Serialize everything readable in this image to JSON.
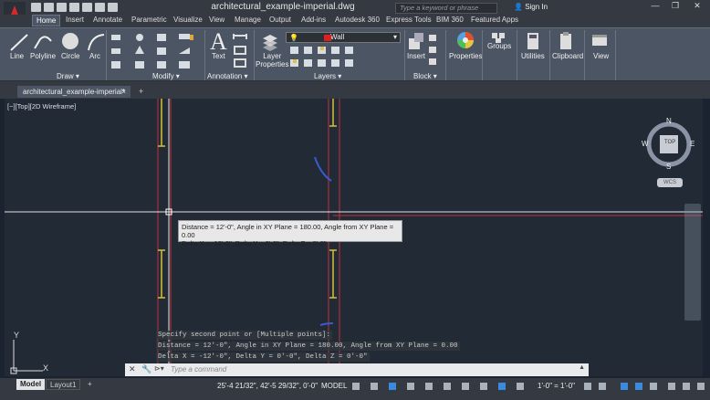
{
  "window": {
    "title": "architectural_example-imperial.dwg",
    "controls": [
      "—",
      "❐",
      "✕"
    ]
  },
  "search": {
    "placeholder": "Type a keyword or phrase"
  },
  "user": {
    "signin_label": "Sign In"
  },
  "ribbon_tabs": [
    "Home",
    "Insert",
    "Annotate",
    "Parametric",
    "Visualize",
    "View",
    "Manage",
    "Output",
    "Add-ins",
    "Autodesk 360",
    "Express Tools",
    "BIM 360",
    "Featured Apps"
  ],
  "active_tab": "Home",
  "ribbon": {
    "draw": {
      "title": "Draw ▾",
      "tools": [
        "Line",
        "Polyline",
        "Circle",
        "Arc"
      ]
    },
    "modify": {
      "title": "Modify ▾"
    },
    "annotation": {
      "title": "Annotation ▾",
      "text_label": "Text"
    },
    "layers": {
      "title": "Layers ▾",
      "properties_label": "Layer\nProperties",
      "current_layer": "Wall",
      "current_layer_color": "#e02020"
    },
    "block": {
      "title": "Block ▾",
      "insert_label": "Insert"
    },
    "properties_label": "Properties",
    "groups_label": "Groups",
    "utilities_label": "Utilities",
    "clipboard_label": "Clipboard",
    "view_label": "View"
  },
  "file_tab": {
    "label": "architectural_example-imperial*",
    "close": "×",
    "new": "+"
  },
  "viewport": {
    "label": "[−][Top][2D Wireframe]",
    "viewcube": {
      "top": "TOP",
      "n": "N",
      "s": "S",
      "e": "E",
      "w": "W",
      "wcs": "WCS"
    }
  },
  "tooltip": {
    "line1": "Distance = 12'-0\",  Angle in XY Plane = 180.00,  Angle from XY Plane = 0.00",
    "line2": "Delta X = -12'-0\",  Delta Y = 0'-0\",   Delta Z = 0'-0\""
  },
  "command_history": [
    "Specify second point or [Multiple points]:",
    "Distance = 12'-0\",  Angle in XY Plane = 180.00,  Angle from XY Plane = 0.00",
    "Delta X = -12'-0\",  Delta Y = 0'-0\",   Delta Z = 0'-0\""
  ],
  "command_line": {
    "placeholder": "Type a command"
  },
  "status": {
    "layout_tabs": [
      "Model",
      "Layout1"
    ],
    "add_layout": "+",
    "coordinates": "25'-4 21/32\", 42'-5 29/32\", 0'-0\"",
    "space": "MODEL",
    "annotation_scale": "1'-0\" = 1'-0\""
  },
  "colors": {
    "background": "#222a36",
    "ribbon": "#4c5563",
    "wall_lines": "#d4c23a",
    "red_lines": "#c0303a"
  }
}
